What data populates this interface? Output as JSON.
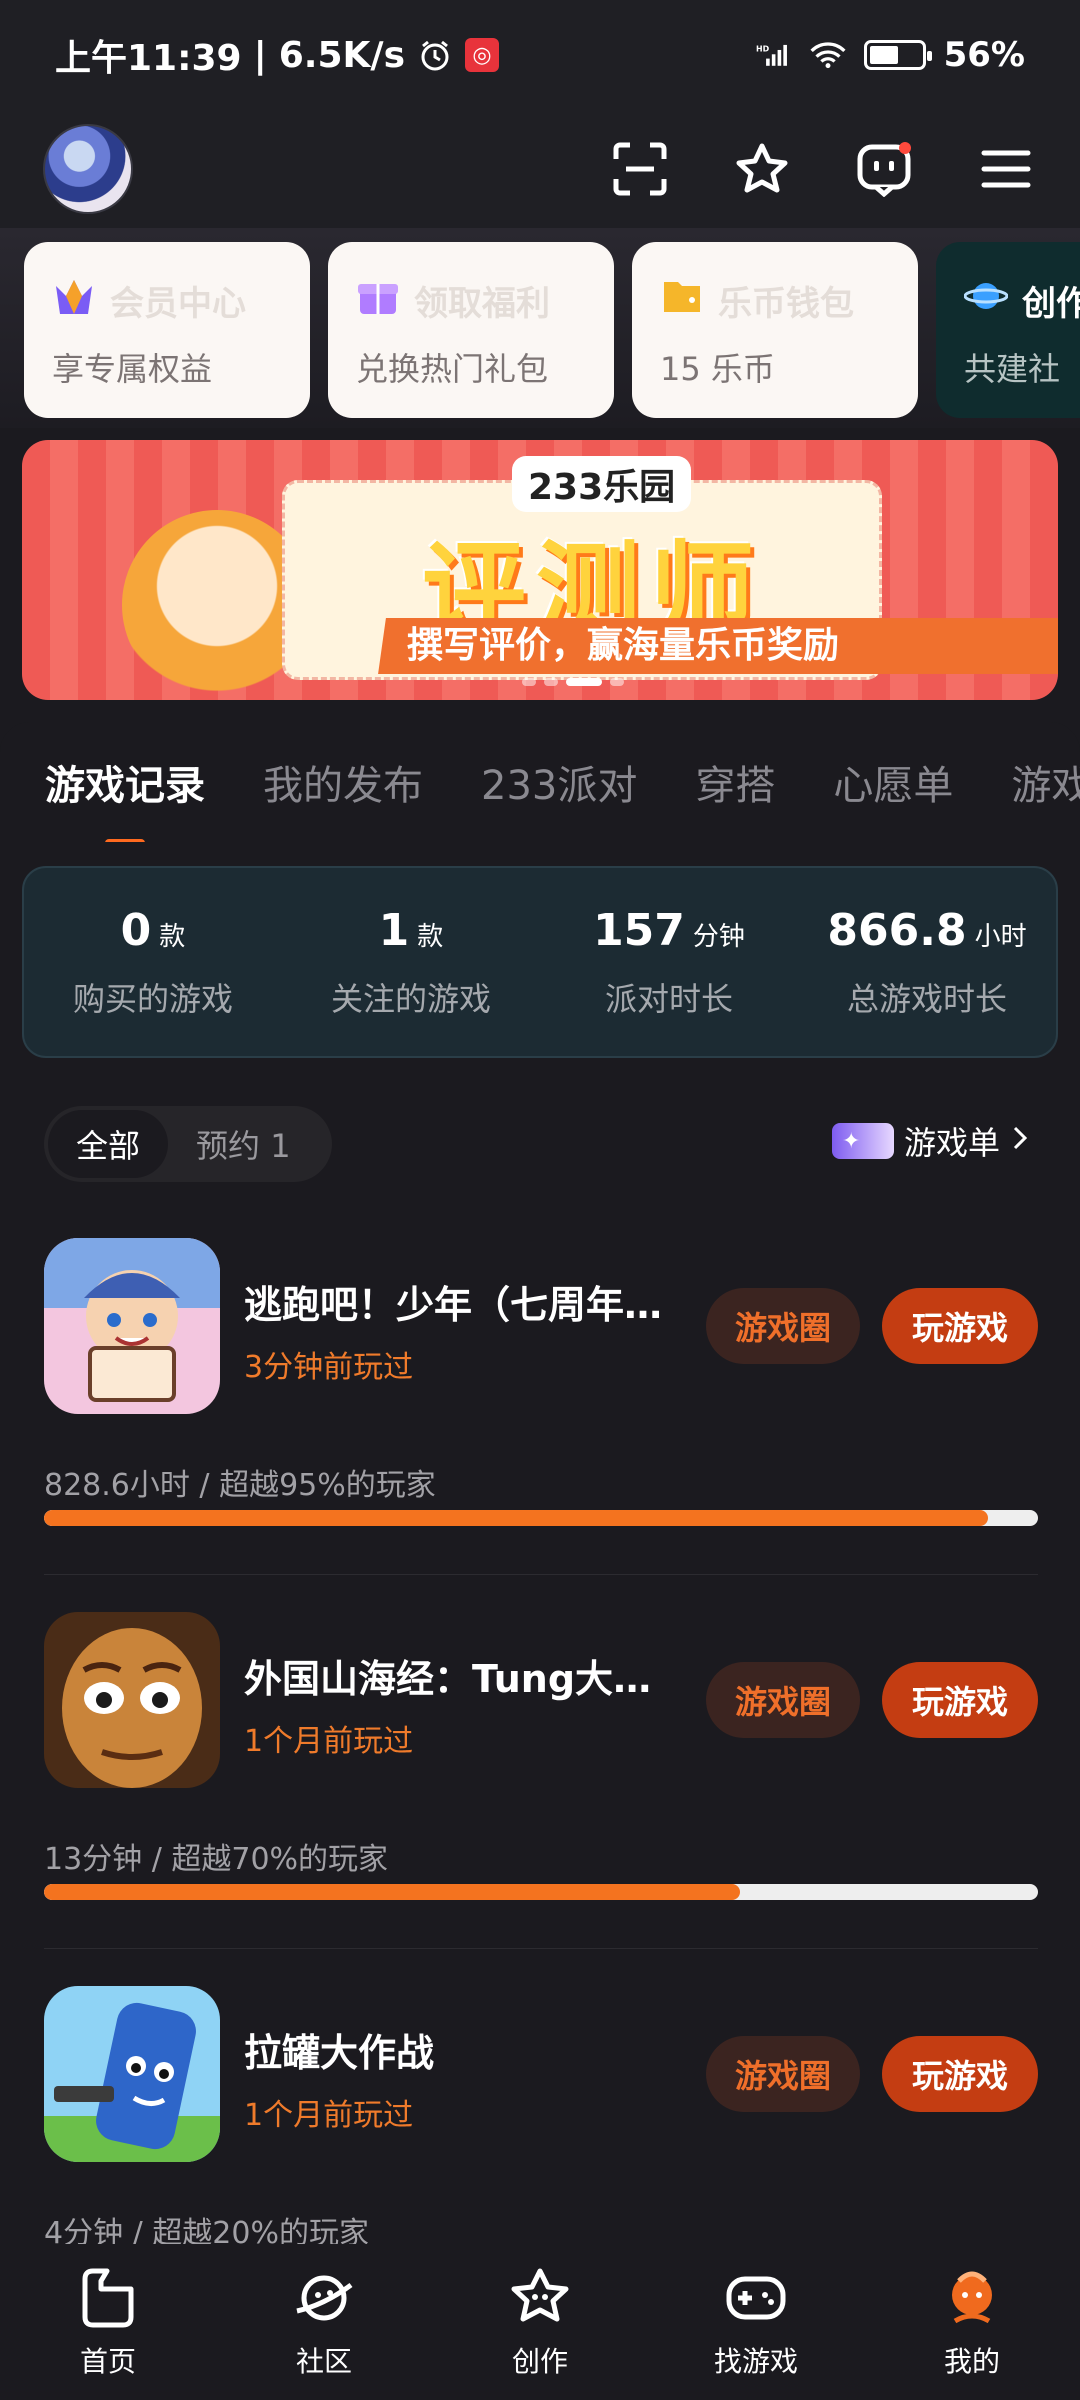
{
  "status_bar": {
    "time": "上午11:39",
    "network_speed": "6.5K/s",
    "battery": "56%",
    "battery_level": 0.56,
    "signal_label": "HD",
    "icons": [
      "alarm-icon",
      "app-notification-icon",
      "signal-icon",
      "wifi-icon",
      "battery-icon"
    ]
  },
  "header": {
    "icons": [
      "scan-icon",
      "star-icon",
      "message-icon",
      "menu-icon"
    ]
  },
  "quick_cards": [
    {
      "title": "会员中心",
      "subtitle": "享专属权益",
      "icon": "crown-icon",
      "accent": "#7a5cf5"
    },
    {
      "title": "领取福利",
      "subtitle": "兑换热门礼包",
      "icon": "gift-icon",
      "accent": "#b07cff"
    },
    {
      "title": "乐币钱包",
      "subtitle": "15 乐币",
      "icon": "wallet-icon",
      "accent": "#f5b62a"
    },
    {
      "title": "创作",
      "subtitle": "共建社",
      "icon": "planet-icon",
      "accent": "#3aa0ff"
    }
  ],
  "banner": {
    "brand": "233乐园",
    "headline": "评测师",
    "slogan": "撰写评价，赢海量乐币奖励",
    "active_slide": 2,
    "slide_count": 4
  },
  "tabs": [
    "游戏记录",
    "我的发布",
    "233派对",
    "穿搭",
    "心愿单",
    "游戏"
  ],
  "stats": [
    {
      "value": "0",
      "unit": "款",
      "label": "购买的游戏"
    },
    {
      "value": "1",
      "unit": "款",
      "label": "关注的游戏"
    },
    {
      "value": "157",
      "unit": "分钟",
      "label": "派对时长"
    },
    {
      "value": "866.8",
      "unit": "小时",
      "label": "总游戏时长"
    }
  ],
  "filters": {
    "all": "全部",
    "reserved": "预约 1",
    "game_list": "游戏单"
  },
  "games": [
    {
      "title": "逃跑吧！少年（七周年庆）",
      "played": "3分钟前玩过",
      "stat_line": "828.6小时 / 超越95%的玩家",
      "progress": 0.95,
      "circle_btn": "游戏圈",
      "play_btn": "玩游戏",
      "icon_colors": [
        "#5d8fd6",
        "#f1c6dd"
      ]
    },
    {
      "title": "外国山海经：Tung大闹…",
      "played": "1个月前玩过",
      "stat_line": "13分钟 / 超越70%的玩家",
      "progress": 0.7,
      "circle_btn": "游戏圈",
      "play_btn": "玩游戏",
      "icon_colors": [
        "#5a3a22",
        "#d9953f"
      ]
    },
    {
      "title": "拉罐大作战",
      "played": "1个月前玩过",
      "stat_line": "4分钟 / 超越20%的玩家",
      "progress": 0.2,
      "circle_btn": "游戏圈",
      "play_btn": "玩游戏",
      "icon_colors": [
        "#2e66c9",
        "#8fd3f5"
      ]
    }
  ],
  "bottom_nav": [
    {
      "label": "首页",
      "icon": "home-icon"
    },
    {
      "label": "社区",
      "icon": "community-planet-icon"
    },
    {
      "label": "创作",
      "icon": "create-star-icon"
    },
    {
      "label": "找游戏",
      "icon": "gamepad-icon"
    },
    {
      "label": "我的",
      "icon": "profile-icon",
      "active": true
    }
  ]
}
